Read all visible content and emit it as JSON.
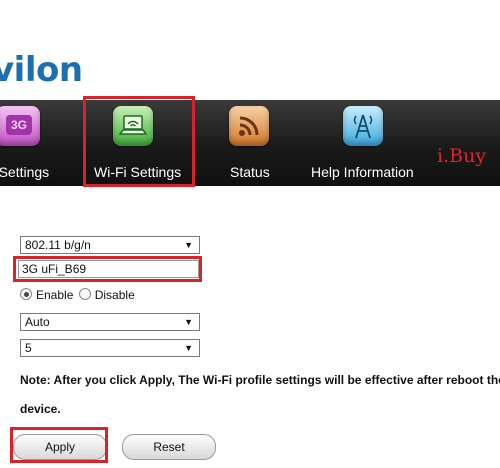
{
  "brand": {
    "logo_text": "vilon",
    "watermark": "i.Buy"
  },
  "nav": {
    "items": [
      {
        "label": "3G Settings",
        "icon": "3g-icon",
        "badge": "3G",
        "active": false
      },
      {
        "label": "Wi-Fi Settings",
        "icon": "wifi-laptop-icon",
        "active": true
      },
      {
        "label": "Status",
        "icon": "rss-icon",
        "active": false
      },
      {
        "label": "Help Information",
        "icon": "antenna-icon",
        "active": false
      }
    ]
  },
  "wifi": {
    "mode_value": "802.11 b/g/n",
    "ssid_value": "3G uFi_B69",
    "broadcast": {
      "enable_label": "Enable",
      "disable_label": "Disable",
      "selected": "Enable"
    },
    "security_value": "Auto",
    "channel_value": "5"
  },
  "note": {
    "line1": "Note: After you click Apply, The Wi-Fi profile settings will be effective after reboot the",
    "line2": "device."
  },
  "buttons": {
    "apply_label": "Apply",
    "reset_label": "Reset"
  },
  "colors": {
    "highlight": "#d8232a",
    "brand": "#1d6fb0",
    "navbar": "#1a1a1a"
  }
}
